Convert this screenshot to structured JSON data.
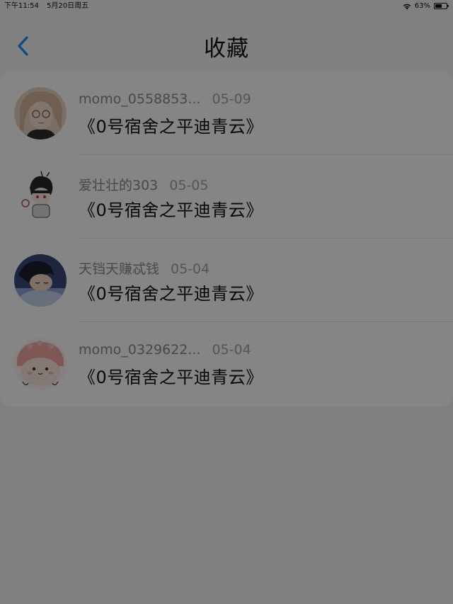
{
  "status_bar": {
    "time": "下午11:54",
    "date": "5月20日周五",
    "battery": "63%",
    "battery_level": 0.63
  },
  "nav": {
    "title": "收藏",
    "back_icon": "chevron-left-icon",
    "accent_color": "#1a8cff"
  },
  "favorites": [
    {
      "username": "momo_0558853...",
      "date": "05-09",
      "title": "《0号宿舍之平迪青云》",
      "avatar": "anime-girl-glasses"
    },
    {
      "username": "爱壮壮的303",
      "date": "05-05",
      "title": "《0号宿舍之平迪青云》",
      "avatar": "chibi-character"
    },
    {
      "username": "天铛天赚忒钱",
      "date": "05-04",
      "title": "《0号宿舍之平迪青云》",
      "avatar": "sleeping-boy"
    },
    {
      "username": "momo_0329622...",
      "date": "05-04",
      "title": "《0号宿舍之平迪青云》",
      "avatar": "pink-blob"
    }
  ],
  "overlay": {
    "visible": true,
    "color": "rgba(0,0,0,0.48)"
  }
}
